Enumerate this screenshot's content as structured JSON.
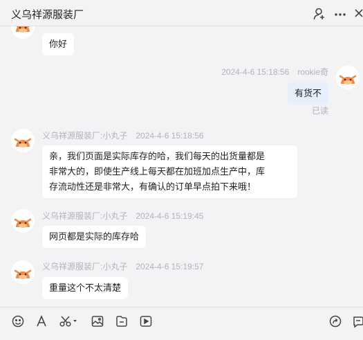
{
  "header": {
    "title": "义乌祥源服装厂"
  },
  "messages": [
    {
      "from": "other",
      "text": "你好"
    },
    {
      "from": "self",
      "name": "rookie奇",
      "time": "2024-4-6 15:18:56",
      "text": "有货不",
      "status": "已读"
    },
    {
      "from": "other",
      "name": "义乌祥源服装厂:小丸子",
      "time": "2024-4-6 15:18:56",
      "lines": [
        "亲，我们页面是实际库存的哈，我们每天的出货量都是",
        "非常大的，即使生产线上每天都在加班加点生产中，库",
        "存流动性还是非常大，有确认的订单早点拍下来哦！"
      ]
    },
    {
      "from": "other",
      "name": "义乌祥源服装厂:小丸子",
      "time": "2024-4-6 15:19:45",
      "text": "网页都是实际的库存哈"
    },
    {
      "from": "other",
      "name": "义乌祥源服装厂:小丸子",
      "time": "2024-4-6 15:19:57",
      "text": "重量这个不太清楚"
    }
  ],
  "icons": {
    "header": [
      "user-icon",
      "more-icon",
      "close-icon"
    ],
    "toolbar": [
      "emoji-icon",
      "font-icon",
      "scissors-icon",
      "image-icon",
      "file-icon",
      "video-icon",
      "share-icon",
      "chat-icon"
    ]
  },
  "colors": {
    "background": "#f3f3f5",
    "bubble_other": "#ffffff",
    "bubble_self": "#e7eefc",
    "avatar_accent": "#f08b45"
  }
}
